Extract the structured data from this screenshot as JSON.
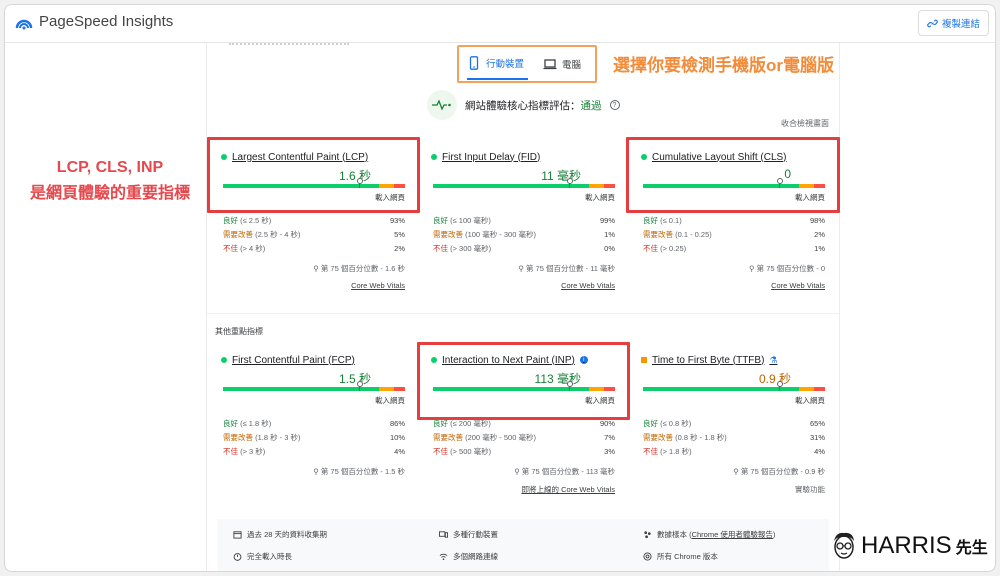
{
  "app": {
    "title": "PageSpeed Insights",
    "copy_link": "複製連結"
  },
  "device_tabs": {
    "mobile": "行動裝置",
    "desktop": "電腦"
  },
  "cwv": {
    "title": "網站體驗核心指標評估：",
    "status": "通過",
    "collapse": "收合檢視畫面"
  },
  "metrics_top": [
    {
      "name": "Largest Contentful Paint (LCP)",
      "value": "1.6 秒",
      "marker_pct": 0.75,
      "load": "載入網頁",
      "dist": [
        {
          "label": "良好",
          "range": "(≤ 2.5 秒)",
          "pct": "93%"
        },
        {
          "label": "需要改善",
          "range": "(2.5 秒 - 4 秒)",
          "pct": "5%"
        },
        {
          "label": "不佳",
          "range": "(> 4 秒)",
          "pct": "2%"
        }
      ],
      "p75": "第 75 個百分位數 - 1.6 秒",
      "link": "Core Web Vitals"
    },
    {
      "name": "First Input Delay (FID)",
      "value": "11 毫秒",
      "marker_pct": 0.75,
      "load": "載入網頁",
      "dist": [
        {
          "label": "良好",
          "range": "(≤ 100 毫秒)",
          "pct": "99%"
        },
        {
          "label": "需要改善",
          "range": "(100 毫秒 - 300 毫秒)",
          "pct": "1%"
        },
        {
          "label": "不佳",
          "range": "(> 300 毫秒)",
          "pct": "0%"
        }
      ],
      "p75": "第 75 個百分位數 - 11 毫秒",
      "link": "Core Web Vitals"
    },
    {
      "name": "Cumulative Layout Shift (CLS)",
      "value": "0",
      "marker_pct": 0.75,
      "load": "載入網頁",
      "dist": [
        {
          "label": "良好",
          "range": "(≤ 0.1)",
          "pct": "98%"
        },
        {
          "label": "需要改善",
          "range": "(0.1 - 0.25)",
          "pct": "2%"
        },
        {
          "label": "不佳",
          "range": "(> 0.25)",
          "pct": "1%"
        }
      ],
      "p75": "第 75 個百分位數 - 0",
      "link": "Core Web Vitals"
    }
  ],
  "other_label": "其他重點指標",
  "metrics_bottom": [
    {
      "name": "First Contentful Paint (FCP)",
      "value": "1.5 秒",
      "marker_pct": 0.75,
      "load": "載入網頁",
      "dist": [
        {
          "label": "良好",
          "range": "(≤ 1.8 秒)",
          "pct": "86%"
        },
        {
          "label": "需要改善",
          "range": "(1.8 秒 - 3 秒)",
          "pct": "10%"
        },
        {
          "label": "不佳",
          "range": "(> 3 秒)",
          "pct": "4%"
        }
      ],
      "p75": "第 75 個百分位數 - 1.5 秒",
      "link": ""
    },
    {
      "name": "Interaction to Next Paint (INP)",
      "value": "113 毫秒",
      "marker_pct": 0.75,
      "load": "載入網頁",
      "dist": [
        {
          "label": "良好",
          "range": "(≤ 200 毫秒)",
          "pct": "90%"
        },
        {
          "label": "需要改善",
          "range": "(200 毫秒 - 500 毫秒)",
          "pct": "7%"
        },
        {
          "label": "不佳",
          "range": "(> 500 毫秒)",
          "pct": "3%"
        }
      ],
      "p75": "第 75 個百分位數 - 113 毫秒",
      "link": "即將上線的 Core Web Vitals"
    },
    {
      "name": "Time to First Byte (TTFB)",
      "value": "0.9 秒",
      "marker_pct": 0.75,
      "load": "載入網頁",
      "dist": [
        {
          "label": "良好",
          "range": "(≤ 0.8 秒)",
          "pct": "65%"
        },
        {
          "label": "需要改善",
          "range": "(0.8 秒 - 1.8 秒)",
          "pct": "31%"
        },
        {
          "label": "不佳",
          "range": "(> 1.8 秒)",
          "pct": "4%"
        }
      ],
      "p75": "第 75 個百分位數 - 0.9 秒",
      "link": "實驗功能"
    }
  ],
  "footer": {
    "period": "過去 28 天的資料收集期",
    "devices": "多種行動裝置",
    "sample_prefix": "數據樣本 (",
    "sample_link": "Chrome 使用者體驗報告",
    "sample_suffix": ")",
    "duration": "完全載入時長",
    "network": "多個網路連線",
    "chrome": "所有 Chrome 版本"
  },
  "annotations": {
    "right": "選擇你要檢測手機版or電腦版",
    "left_line1": "LCP, CLS, INP",
    "left_line2": "是網頁體驗的重要指標"
  },
  "brand": {
    "name": "HARRIS",
    "suffix": "先生"
  },
  "colors": {
    "good": "#0cce6b",
    "average": "#ffa400",
    "poor": "#ff4e42",
    "accent": "#1a73e8",
    "annot_orange": "#f28c3a",
    "annot_red": "#e5484d"
  }
}
